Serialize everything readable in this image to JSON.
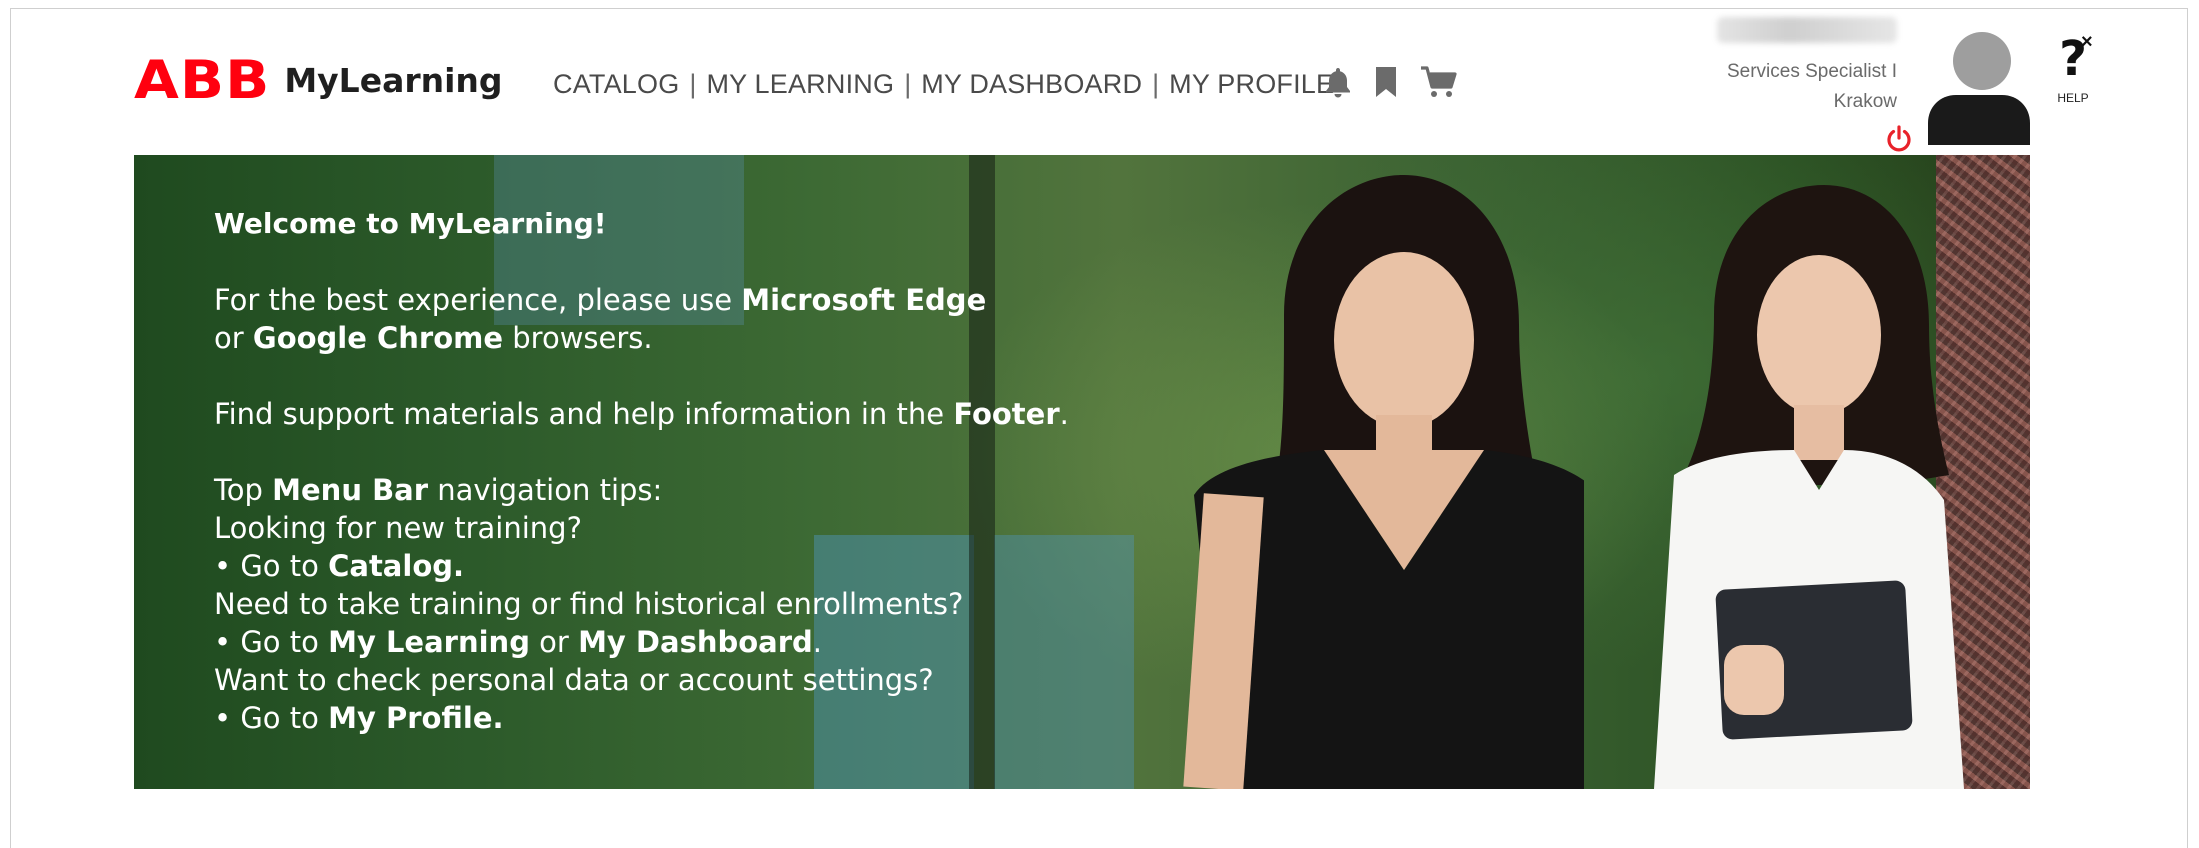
{
  "header": {
    "logo_brand": "ABB",
    "logo_product": "MyLearning",
    "nav": [
      {
        "label": "CATALOG"
      },
      {
        "label": "MY LEARNING"
      },
      {
        "label": "MY DASHBOARD"
      },
      {
        "label": "MY PROFILE"
      }
    ],
    "nav_separator": "|",
    "icons": [
      "bell-icon",
      "bookmark-icon",
      "cart-icon"
    ],
    "user": {
      "role": "Services Specialist I",
      "location": "Krakow"
    },
    "help_label": "HELP",
    "help_glyph": "?",
    "close_glyph": "×"
  },
  "banner": {
    "welcome": "Welcome to MyLearning!",
    "browser_line1_pre": "For the best experience, please use ",
    "browser_line1_bold": "Microsoft Edge",
    "browser_line2_pre": "or ",
    "browser_line2_bold": "Google Chrome",
    "browser_line2_post": " browsers.",
    "support_pre": "Find support materials and help information in the ",
    "support_bold": "Footer",
    "support_post": ".",
    "tips_pre": "Top ",
    "tips_bold": "Menu Bar",
    "tips_post": " navigation tips:",
    "q1": "Looking for new training?",
    "a1_pre": "• Go to ",
    "a1_bold": "Catalog.",
    "q2": "Need to take training or find historical enrollments?",
    "a2_pre": "• Go to ",
    "a2_bold1": "My Learning",
    "a2_mid": " or ",
    "a2_bold2": "My Dashboard",
    "a2_post": ".",
    "q3": "Want to check personal data or account settings?",
    "a3_pre": "• Go to ",
    "a3_bold": "My Profile."
  },
  "colors": {
    "brand_red": "#ff000f",
    "power_red": "#e8222a",
    "nav_text": "#4a4a4a"
  }
}
